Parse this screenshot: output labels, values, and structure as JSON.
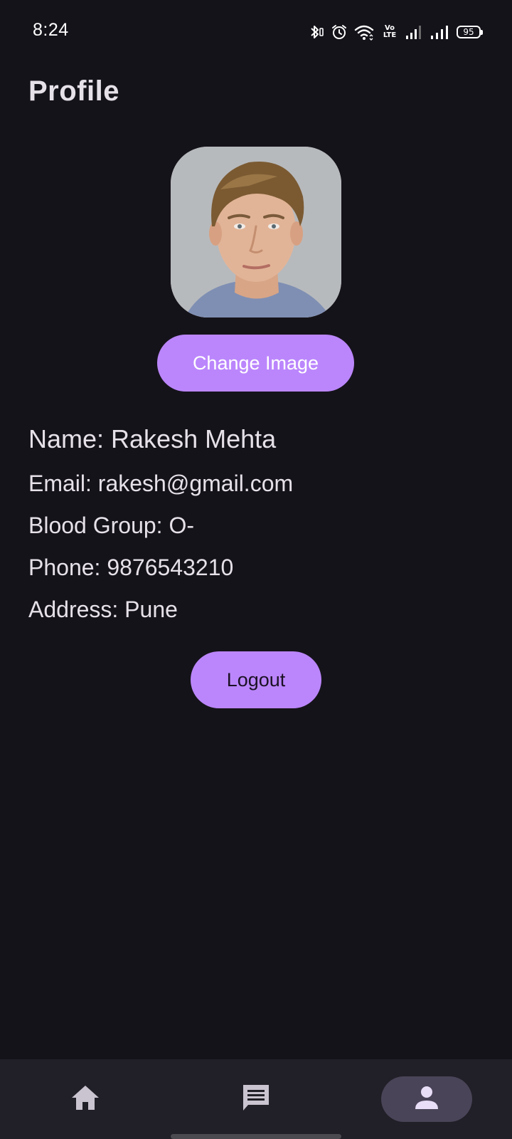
{
  "status_bar": {
    "time": "8:24",
    "battery_level": "95",
    "network_label": "Vo LTE",
    "icons": [
      "bluetooth-icon",
      "alarm-icon",
      "wifi-icon",
      "volte-icon",
      "signal-sim1-icon",
      "signal-sim2-icon",
      "battery-icon"
    ]
  },
  "header": {
    "title": "Profile"
  },
  "profile": {
    "change_image_label": "Change Image",
    "name_line": "Name: Rakesh Mehta",
    "email_line": "Email: rakesh@gmail.com",
    "blood_group_line": "Blood Group: O-",
    "phone_line": "Phone: 9876543210",
    "address_line": "Address: Pune",
    "logout_label": "Logout"
  },
  "bottom_nav": {
    "items": [
      {
        "icon": "home-icon",
        "active": false
      },
      {
        "icon": "message-icon",
        "active": false
      },
      {
        "icon": "person-icon",
        "active": true
      }
    ]
  },
  "colors": {
    "background": "#15131a",
    "accent": "#bb86fc",
    "text": "#e6e1e9",
    "nav_background": "#211f27",
    "nav_active_pill": "#4a4458"
  }
}
